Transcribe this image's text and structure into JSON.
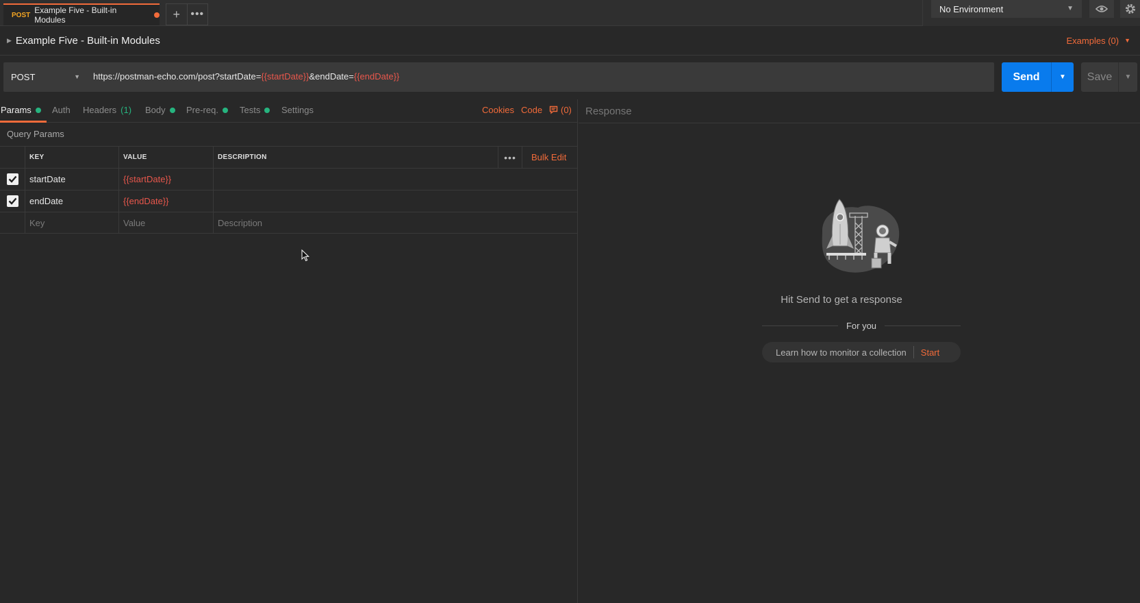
{
  "tab": {
    "method": "POST",
    "title": "Example Five - Built-in Modules",
    "add_icon": "+",
    "more_icon": "•••"
  },
  "environment": {
    "selected": "No Environment"
  },
  "request": {
    "name": "Example Five - Built-in Modules",
    "examples_label": "Examples (0)",
    "method": "POST",
    "url_parts": {
      "base": "https://postman-echo.com/post?startDate=",
      "var1": "{{startDate}}",
      "mid": "&endDate=",
      "var2": "{{endDate}}"
    },
    "send_label": "Send",
    "save_label": "Save"
  },
  "request_tabs": {
    "params": "Params",
    "auth": "Auth",
    "headers": "Headers",
    "headers_count": "(1)",
    "body": "Body",
    "prereq": "Pre-req.",
    "tests": "Tests",
    "settings": "Settings",
    "cookies": "Cookies",
    "code": "Code",
    "comments": "(0)"
  },
  "query_params": {
    "title": "Query Params",
    "headers": {
      "key": "KEY",
      "value": "VALUE",
      "description": "DESCRIPTION",
      "more": "•••",
      "bulk_edit": "Bulk Edit"
    },
    "rows": [
      {
        "checked": true,
        "key": "startDate",
        "value": "{{startDate}}",
        "description": ""
      },
      {
        "checked": true,
        "key": "endDate",
        "value": "{{endDate}}",
        "description": ""
      }
    ],
    "placeholders": {
      "key": "Key",
      "value": "Value",
      "description": "Description"
    }
  },
  "response": {
    "title": "Response",
    "empty_message": "Hit Send to get a response",
    "for_you": "For you",
    "learn_text": "Learn how to monitor a collection",
    "start_label": "Start"
  },
  "colors": {
    "accent": "#f26b3a",
    "send_blue": "#097bed",
    "variable_red": "#e8574c",
    "status_green": "#26b47f"
  }
}
